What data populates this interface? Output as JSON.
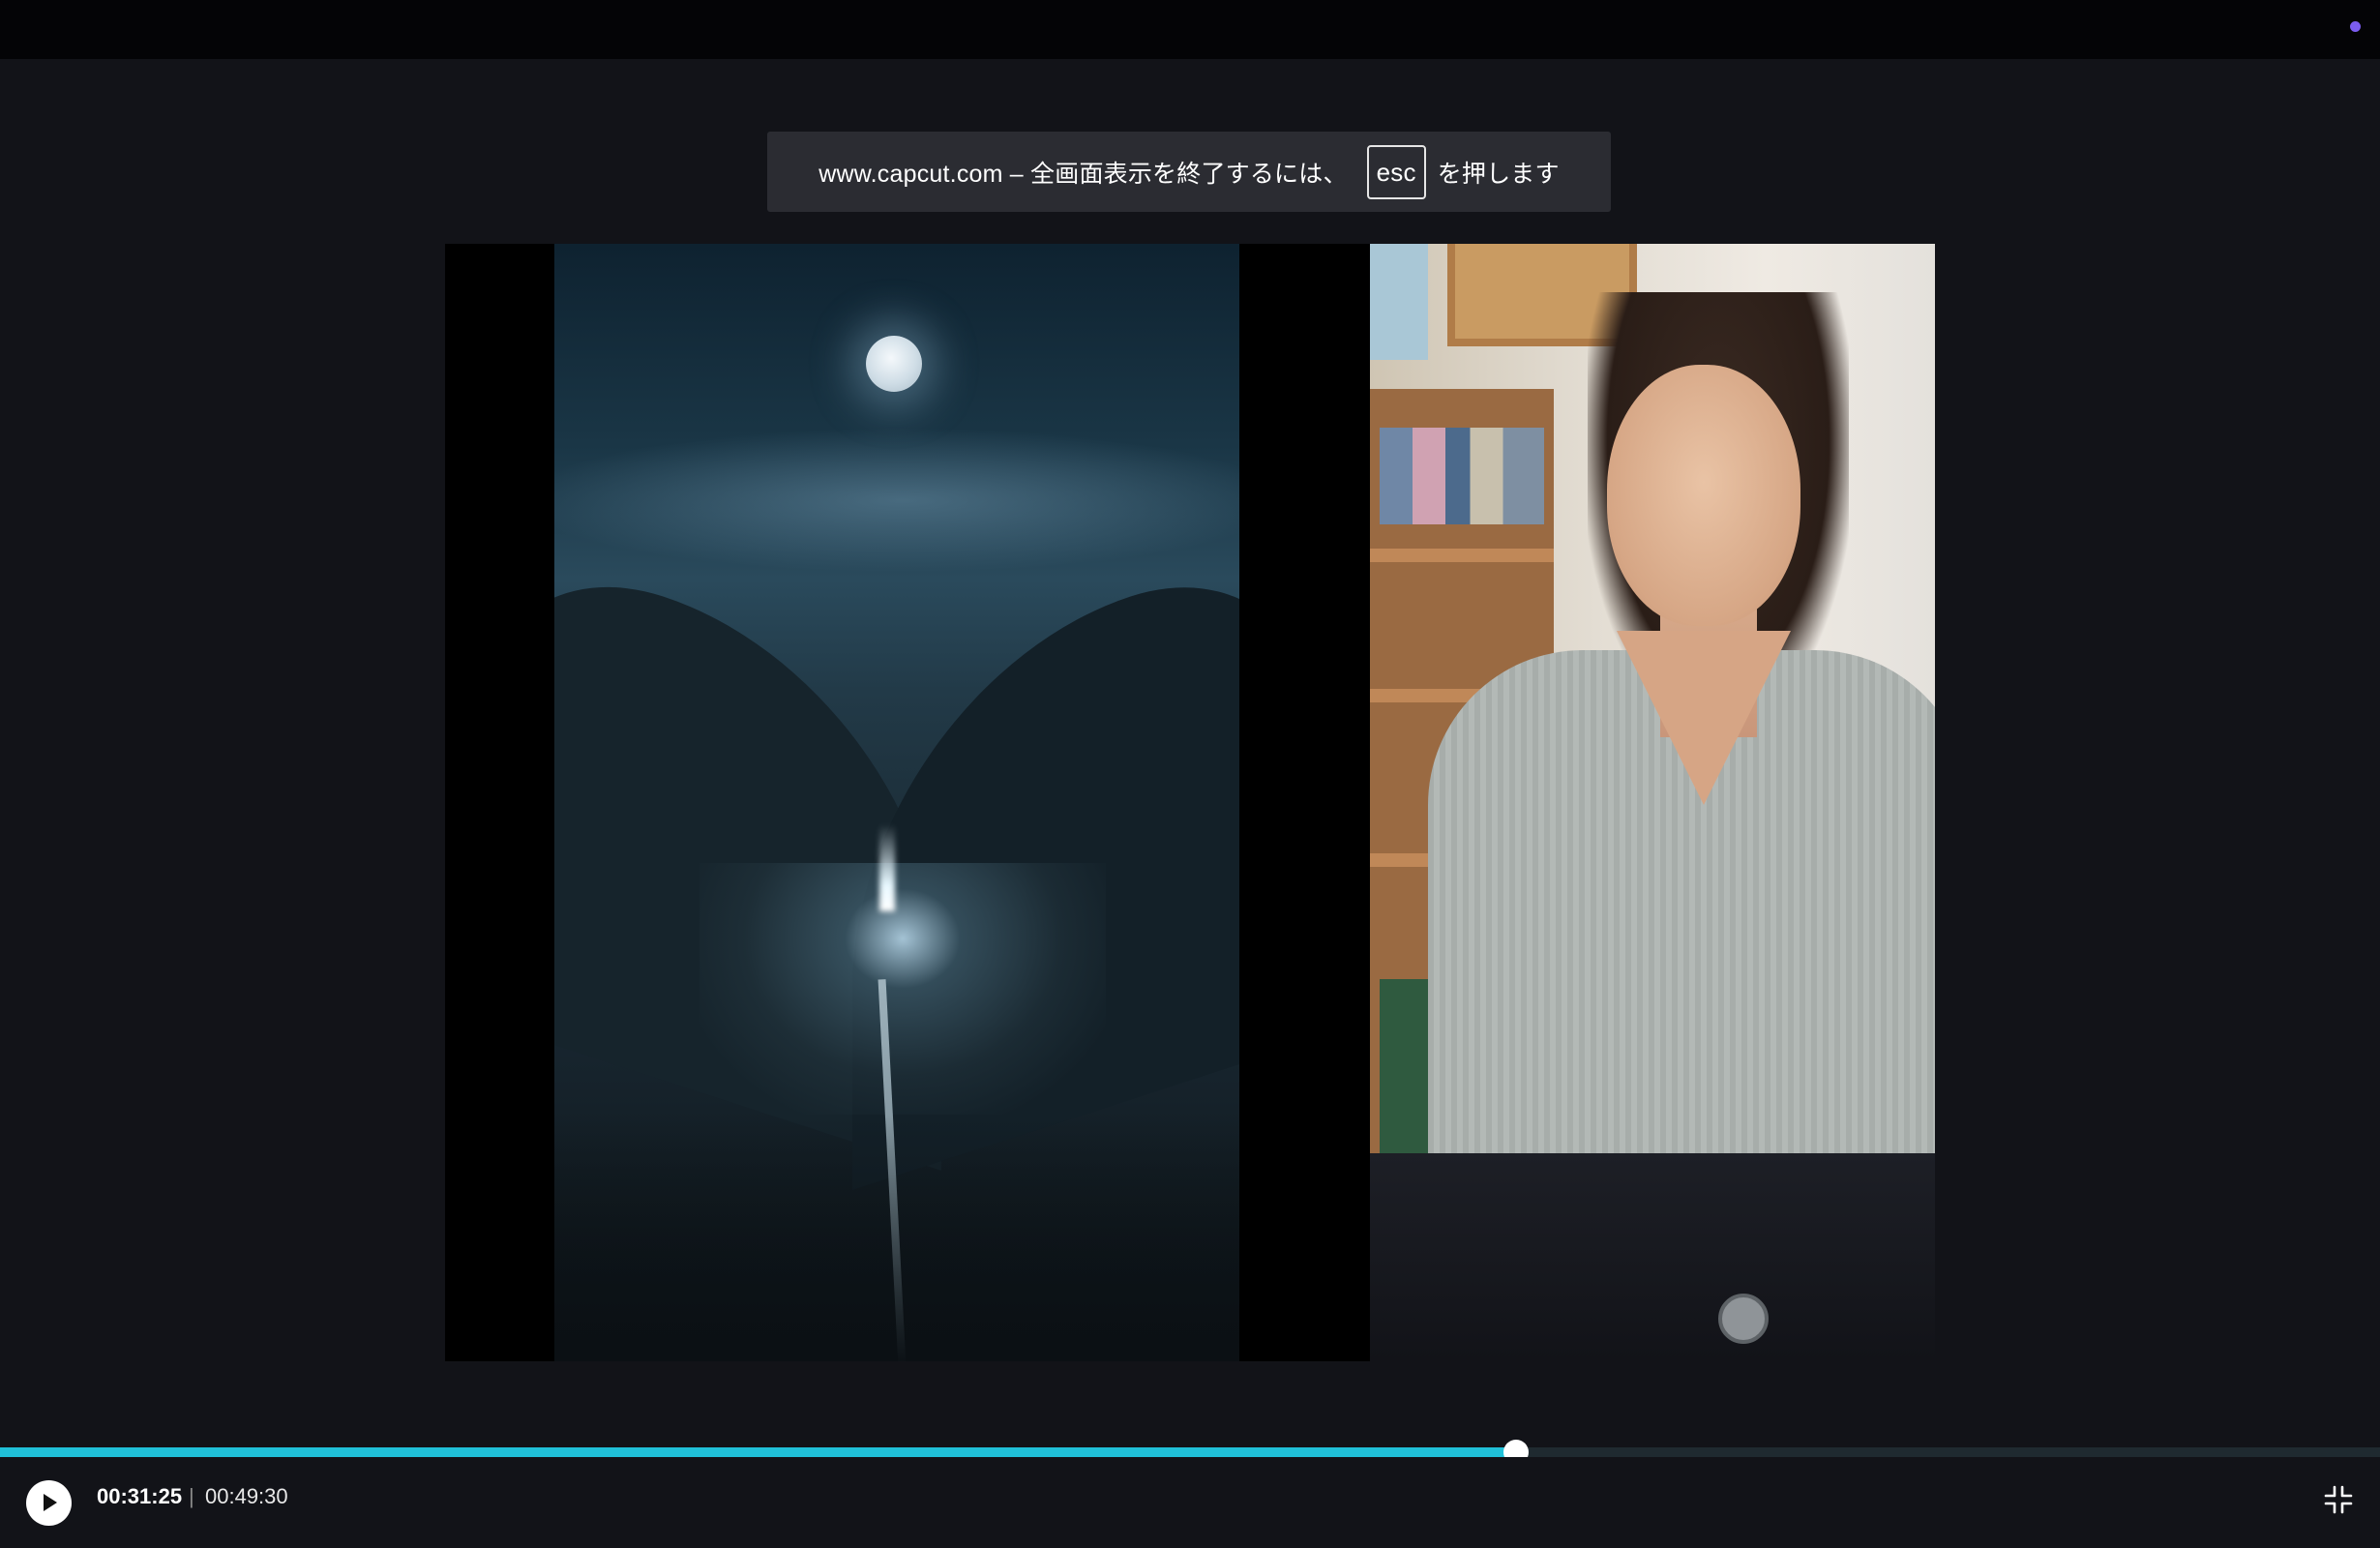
{
  "topbar": {
    "indicator_color": "#7b5cf0"
  },
  "fullscreen_notice": {
    "prefix": "www.capcut.com – 全画面表示を終了するには、",
    "key": "esc",
    "suffix": "を押します"
  },
  "player": {
    "current_time": "00:31:25",
    "separator": "|",
    "total_time": "00:49:30",
    "progress": 0.637,
    "progress_color": "#20c0d8",
    "play_icon": "play-icon",
    "exit_fullscreen_icon": "exit-fullscreen-icon"
  }
}
